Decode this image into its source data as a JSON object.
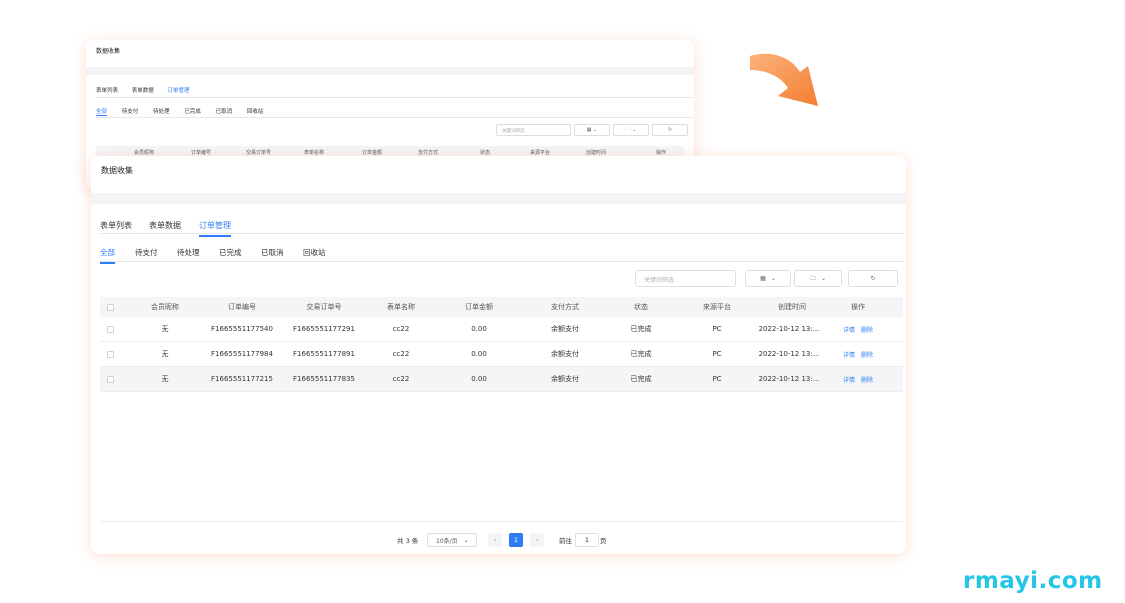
{
  "small_card": {
    "title": "数据收集",
    "tabs": [
      "表单列表",
      "表单数据",
      "订单管理"
    ],
    "subtabs": [
      "全部",
      "待支付",
      "待处理",
      "已完成",
      "已取消",
      "回收站"
    ],
    "search_placeholder": "关键词筛选",
    "columns": [
      "会员昵称",
      "订单编号",
      "交易订单号",
      "表单名称",
      "订单金额",
      "支付方式",
      "状态",
      "来源平台",
      "创建时间",
      "操作"
    ]
  },
  "main": {
    "title": "数据收集",
    "tabs": [
      {
        "label": "表单列表",
        "active": false
      },
      {
        "label": "表单数据",
        "active": false
      },
      {
        "label": "订单管理",
        "active": true
      }
    ],
    "subtabs": [
      {
        "label": "全部",
        "active": true
      },
      {
        "label": "待支付",
        "active": false
      },
      {
        "label": "待处理",
        "active": false
      },
      {
        "label": "已完成",
        "active": false
      },
      {
        "label": "已取消",
        "active": false
      },
      {
        "label": "回收站",
        "active": false
      }
    ],
    "search_placeholder": "关键词筛选",
    "toolbar_icons": [
      "grid-icon",
      "folder-icon",
      "refresh-icon"
    ],
    "columns": [
      "会员昵称",
      "订单编号",
      "交易订单号",
      "表单名称",
      "订单金额",
      "支付方式",
      "状态",
      "来源平台",
      "创建时间",
      "操作"
    ],
    "rows": [
      {
        "nickname": "无",
        "order_no": "F1665551177540",
        "trade_no": "F1665551177291",
        "form_name": "cc22",
        "amount": "0.00",
        "pay_method": "余额支付",
        "status": "已完成",
        "platform": "PC",
        "created": "2022-10-12 13:...",
        "actions": [
          "详情",
          "删除"
        ]
      },
      {
        "nickname": "无",
        "order_no": "F1665551177984",
        "trade_no": "F1665551177891",
        "form_name": "cc22",
        "amount": "0.00",
        "pay_method": "余额支付",
        "status": "已完成",
        "platform": "PC",
        "created": "2022-10-12 13:...",
        "actions": [
          "详情",
          "删除"
        ]
      },
      {
        "nickname": "无",
        "order_no": "F1665551177215",
        "trade_no": "F1665551177835",
        "form_name": "cc22",
        "amount": "0.00",
        "pay_method": "余额支付",
        "status": "已完成",
        "platform": "PC",
        "created": "2022-10-12 13:...",
        "actions": [
          "详情",
          "删除"
        ]
      }
    ],
    "pagination": {
      "total_text": "共 3 条",
      "page_size": "10条/页",
      "current_page": "1",
      "goto_label": "前往",
      "goto_value": "1",
      "page_unit": "页"
    }
  },
  "colors": {
    "accent": "#2f7df6",
    "arrow": "#f58a3c",
    "watermark": "#23c6e6"
  },
  "watermark": "rmayi.com"
}
